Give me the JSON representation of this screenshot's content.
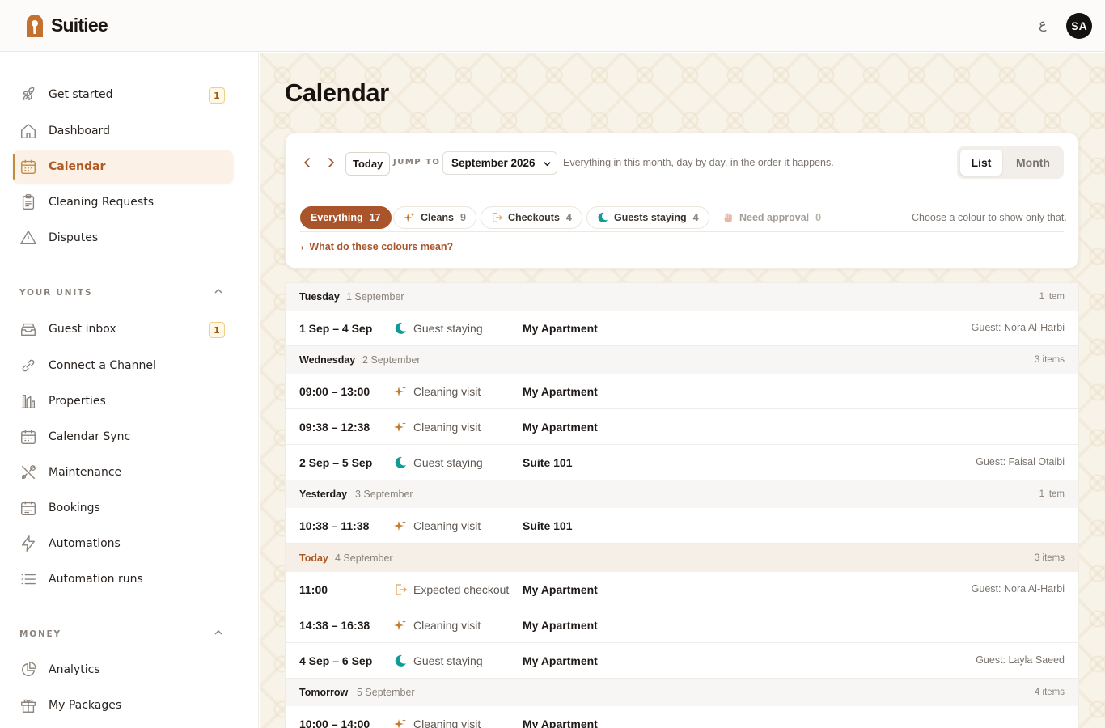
{
  "app": {
    "name": "Suitiee",
    "lang_toggle": "ع",
    "avatar_initials": "SA"
  },
  "colors": {
    "accent": "#a9542a",
    "active_nav_bg": "#fbf1e6",
    "teal": "#0f9c97",
    "gold_badge": "#f0cf8d"
  },
  "sidebar": {
    "items_top": [
      {
        "label": "Get started",
        "icon": "rocket-icon",
        "badge": "1"
      },
      {
        "label": "Dashboard",
        "icon": "home-icon"
      },
      {
        "label": "Calendar",
        "icon": "calendar-icon",
        "active": true
      },
      {
        "label": "Cleaning Requests",
        "icon": "clipboard-icon"
      },
      {
        "label": "Disputes",
        "icon": "warning-icon"
      }
    ],
    "section_units": "YOUR UNITS",
    "items_units": [
      {
        "label": "Guest inbox",
        "icon": "inbox-icon",
        "badge": "1"
      },
      {
        "label": "Connect a Channel",
        "icon": "link-icon"
      },
      {
        "label": "Properties",
        "icon": "building-icon"
      },
      {
        "label": "Calendar Sync",
        "icon": "calendar-sync-icon"
      },
      {
        "label": "Maintenance",
        "icon": "tools-icon"
      },
      {
        "label": "Bookings",
        "icon": "bookings-icon"
      },
      {
        "label": "Automations",
        "icon": "bolt-icon"
      },
      {
        "label": "Automation runs",
        "icon": "list-icon"
      }
    ],
    "section_money": "MONEY",
    "items_money": [
      {
        "label": "Analytics",
        "icon": "pie-chart-icon"
      },
      {
        "label": "My Packages",
        "icon": "gift-icon"
      }
    ]
  },
  "page": {
    "title": "Calendar"
  },
  "toolbar": {
    "today": "Today",
    "jump_to": "JUMP TO",
    "month": "September 2026",
    "help": "Everything in this month, day by day, in the order it happens.",
    "view_list": "List",
    "view_month": "Month"
  },
  "filters": {
    "chips": [
      {
        "label": "Everything",
        "count": "17"
      },
      {
        "label": "Cleans",
        "count": "9"
      },
      {
        "label": "Checkouts",
        "count": "4"
      },
      {
        "label": "Guests staying",
        "count": "4"
      },
      {
        "label": "Need approval",
        "count": "0"
      }
    ],
    "hint": "Choose a colour to show only that.",
    "legend_link": "What do these colours mean?"
  },
  "days": [
    {
      "name": "Tuesday",
      "date": "1 September",
      "count": "1 item",
      "rows": [
        {
          "time": "1 Sep – 4 Sep",
          "kind": "Guest staying",
          "unit": "My Apartment",
          "guest": "Guest: Nora Al-Harbi"
        }
      ]
    },
    {
      "name": "Wednesday",
      "date": "2 September",
      "count": "3 items",
      "rows": [
        {
          "time": "09:00 – 13:00",
          "kind": "Cleaning visit",
          "unit": "My Apartment",
          "guest": ""
        },
        {
          "time": "09:38 – 12:38",
          "kind": "Cleaning visit",
          "unit": "My Apartment",
          "guest": ""
        },
        {
          "time": "2 Sep – 5 Sep",
          "kind": "Guest staying",
          "unit": "Suite 101",
          "guest": "Guest: Faisal Otaibi"
        }
      ]
    },
    {
      "name": "Yesterday",
      "date": "3 September",
      "count": "1 item",
      "rows": [
        {
          "time": "10:38 – 11:38",
          "kind": "Cleaning visit",
          "unit": "Suite 101",
          "guest": ""
        }
      ]
    },
    {
      "name": "Today",
      "date": "4 September",
      "count": "3 items",
      "rows": [
        {
          "time": "11:00",
          "kind": "Expected checkout",
          "unit": "My Apartment",
          "guest": "Guest: Nora Al-Harbi"
        },
        {
          "time": "14:38 – 16:38",
          "kind": "Cleaning visit",
          "unit": "My Apartment",
          "guest": ""
        },
        {
          "time": "4 Sep – 6 Sep",
          "kind": "Guest staying",
          "unit": "My Apartment",
          "guest": "Guest: Layla Saeed"
        }
      ]
    },
    {
      "name": "Tomorrow",
      "date": "5 September",
      "count": "4 items",
      "rows": [
        {
          "time": "10:00 – 14:00",
          "kind": "Cleaning visit",
          "unit": "My Apartment",
          "guest": ""
        }
      ]
    }
  ]
}
